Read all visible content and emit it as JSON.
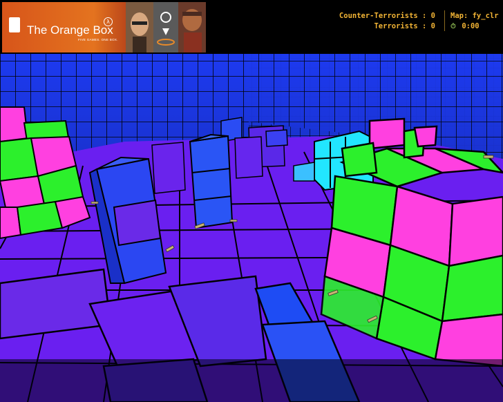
{
  "banner": {
    "title": "The Orange Box",
    "tagline": "FIVE GAMES. ONE BOX.",
    "lambda": "λ",
    "colors": {
      "orange": "#e4731f",
      "dark": "#3a3a3a"
    }
  },
  "scoreboard": {
    "ct_label": "Counter-Terrorists : 0",
    "t_label": "Terrorists : 0",
    "map_label": "Map: fy_clr",
    "timer": "0:00",
    "timer_icon": "stopwatch-icon",
    "color": "#f2b435"
  },
  "scene": {
    "palette": {
      "blue": "#1a3ef0",
      "violet": "#6a22f5",
      "magenta": "#ff40e0",
      "green": "#2cf02c",
      "cyan": "#20e8ff",
      "grid_line": "#000000"
    }
  }
}
